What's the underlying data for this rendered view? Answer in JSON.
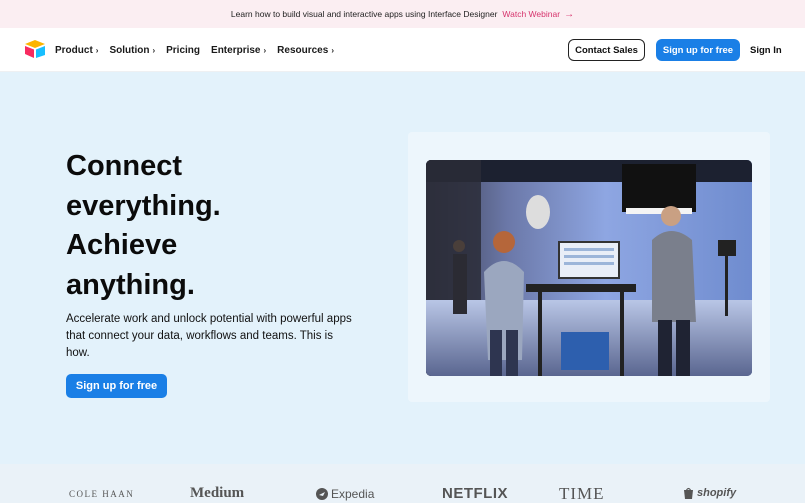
{
  "banner": {
    "text": "Learn how to build visual and interactive apps using Interface Designer",
    "link": "Watch Webinar",
    "arrow": "→"
  },
  "nav": {
    "items": [
      {
        "label": "Product",
        "chevron": "›"
      },
      {
        "label": "Solution",
        "chevron": "›"
      },
      {
        "label": "Pricing"
      },
      {
        "label": "Enterprise",
        "chevron": "›"
      },
      {
        "label": "Resources",
        "chevron": "›"
      }
    ],
    "contact": "Contact Sales",
    "signup": "Sign up for free",
    "signin": "Sign In"
  },
  "hero": {
    "headline": [
      "Connect",
      "everything.",
      "Achieve",
      "anything."
    ],
    "subtext": "Accelerate work and unlock potential with powerful apps that connect your data, workflows and teams. This is how.",
    "cta": "Sign up for free"
  },
  "logos": {
    "colehaan": "COLE HAAN",
    "medium": "Medium",
    "expedia": "Expedia",
    "netflix": "NETFLIX",
    "time": "TIME",
    "shopify": "shopify"
  },
  "colors": {
    "accent": "#1a7fe6",
    "banner_link": "#d6336c",
    "hero_bg": "#e3f2fb"
  }
}
